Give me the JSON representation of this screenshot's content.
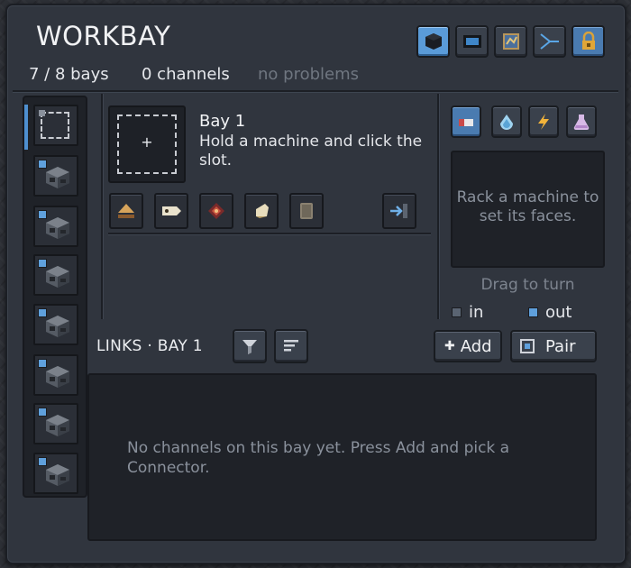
{
  "window": {
    "title": "WORKBAY",
    "header_icons": [
      "cube-icon",
      "screen-icon",
      "blueprint-icon",
      "network-icon",
      "lock-icon"
    ]
  },
  "status": {
    "bays": "7 / 8 bays",
    "channels": "0 channels",
    "problems": "no problems"
  },
  "bay": {
    "title": "Bay 1",
    "description": "Hold a machine and click the slot.",
    "slot_icon": "+",
    "tools": [
      "eject-icon",
      "tag-icon",
      "compass-icon",
      "scroll-icon",
      "tablet-icon",
      "export-icon"
    ]
  },
  "faces": {
    "tabs": [
      "item-icon",
      "fluid-icon",
      "energy-icon",
      "gas-icon"
    ],
    "rack_hint": "Rack a machine to set its faces.",
    "drag_hint": "Drag to turn",
    "legend_in": "in",
    "legend_out": "out"
  },
  "links": {
    "label": "LINKS · BAY 1",
    "filter_icon": "filter-icon",
    "sort_icon": "sort-icon",
    "add_label": "Add",
    "add_glyph": "✚",
    "pair_label": "Pair",
    "empty_message": "No channels on this bay yet. Press Add and pick a Connector."
  },
  "colors": {
    "accent": "#4a7bb0",
    "in": "#5a6472",
    "out": "#5fa0dc"
  }
}
